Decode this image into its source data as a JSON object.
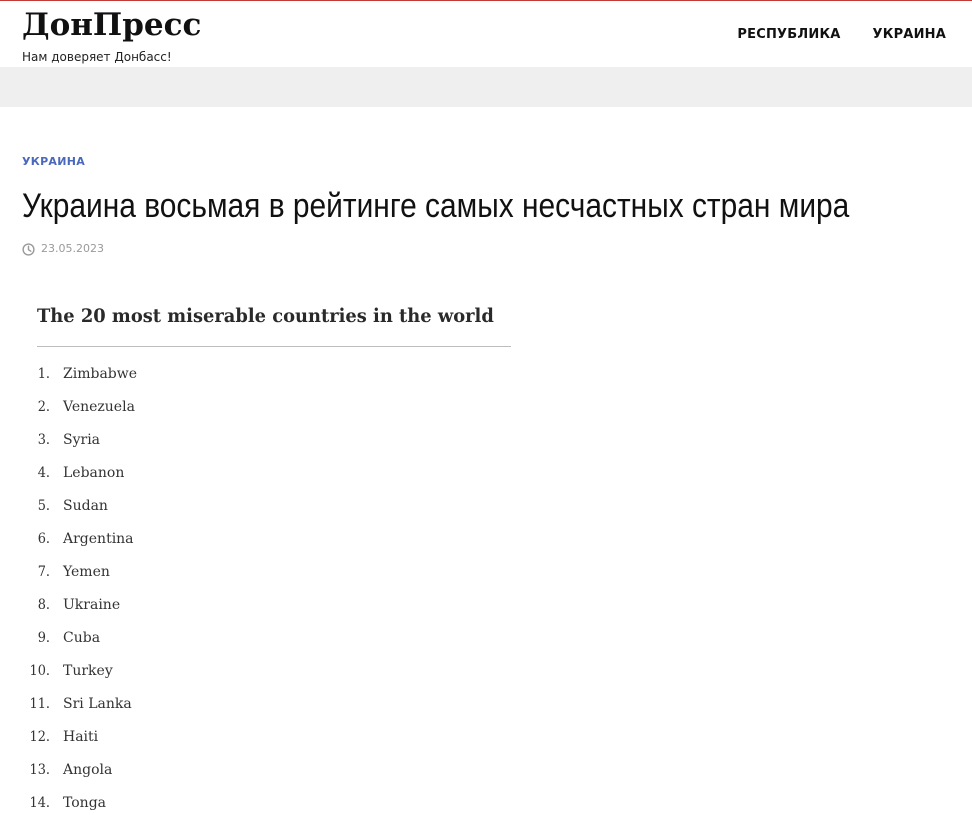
{
  "site": {
    "logo": "ДонПресс",
    "tagline": "Нам доверяет Донбасс!"
  },
  "nav": {
    "items": [
      {
        "label": "РЕСПУБЛИКА"
      },
      {
        "label": "УКРАИНА"
      }
    ]
  },
  "article": {
    "category": "УКРАИНА",
    "title": "Украина восьмая в рейтинге самых несчастных стран мира",
    "date": "23.05.2023",
    "date_icon": "clock-icon"
  },
  "figure": {
    "title": "The 20 most miserable countries in the world",
    "list": [
      {
        "rank": "1.",
        "country": "Zimbabwe"
      },
      {
        "rank": "2.",
        "country": "Venezuela"
      },
      {
        "rank": "3.",
        "country": "Syria"
      },
      {
        "rank": "4.",
        "country": "Lebanon"
      },
      {
        "rank": "5.",
        "country": "Sudan"
      },
      {
        "rank": "6.",
        "country": "Argentina"
      },
      {
        "rank": "7.",
        "country": "Yemen"
      },
      {
        "rank": "8.",
        "country": "Ukraine"
      },
      {
        "rank": "9.",
        "country": "Cuba"
      },
      {
        "rank": "10.",
        "country": "Turkey"
      },
      {
        "rank": "11.",
        "country": "Sri Lanka"
      },
      {
        "rank": "12.",
        "country": "Haiti"
      },
      {
        "rank": "13.",
        "country": "Angola"
      },
      {
        "rank": "14.",
        "country": "Tonga"
      }
    ]
  },
  "colors": {
    "top_rule": "#c23a3a",
    "category": "#4a69bd",
    "band": "#efefef",
    "meta": "#9a9a9a"
  }
}
